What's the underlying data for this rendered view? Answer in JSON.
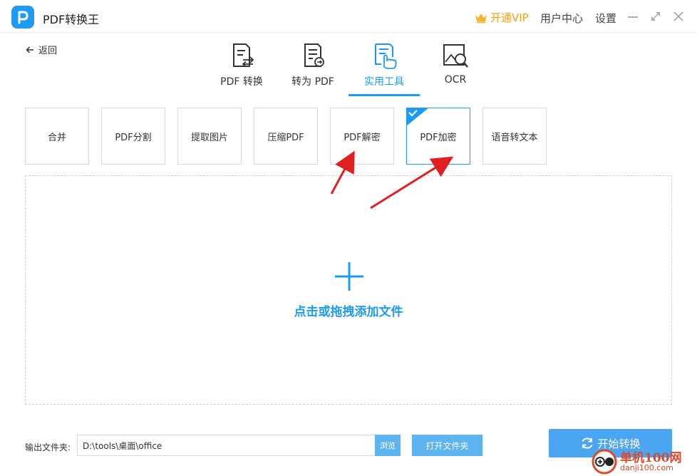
{
  "titlebar": {
    "app_title": "PDF转换王",
    "vip_label": "开通VIP",
    "user_center": "用户中心",
    "settings": "设置"
  },
  "nav": {
    "back_label": "返回"
  },
  "tabs": [
    {
      "label": "PDF 转换",
      "icon": "pdf-convert-icon",
      "active": false
    },
    {
      "label": "转为 PDF",
      "icon": "to-pdf-icon",
      "active": false
    },
    {
      "label": "实用工具",
      "icon": "tools-icon",
      "active": true
    },
    {
      "label": "OCR",
      "icon": "ocr-icon",
      "active": false
    }
  ],
  "tools": [
    {
      "label": "合并",
      "selected": false
    },
    {
      "label": "PDF分割",
      "selected": false
    },
    {
      "label": "提取图片",
      "selected": false
    },
    {
      "label": "压缩PDF",
      "selected": false
    },
    {
      "label": "PDF解密",
      "selected": false
    },
    {
      "label": "PDF加密",
      "selected": true
    },
    {
      "label": "语音转文本",
      "selected": false
    }
  ],
  "dropzone": {
    "label": "点击或拖拽添加文件"
  },
  "output": {
    "label": "输出文件夹:",
    "path": "D:\\tools\\桌面\\office",
    "browse_label": "浏览",
    "open_folder_label": "打开文件夹"
  },
  "start_button": {
    "label": "开始转换"
  },
  "watermark": {
    "title": "单机100网",
    "url": "danji100.com"
  },
  "colors": {
    "accent": "#1e9bf0",
    "vip": "#f0a020",
    "arrow": "#e02020",
    "watermark": "#e0472a"
  }
}
